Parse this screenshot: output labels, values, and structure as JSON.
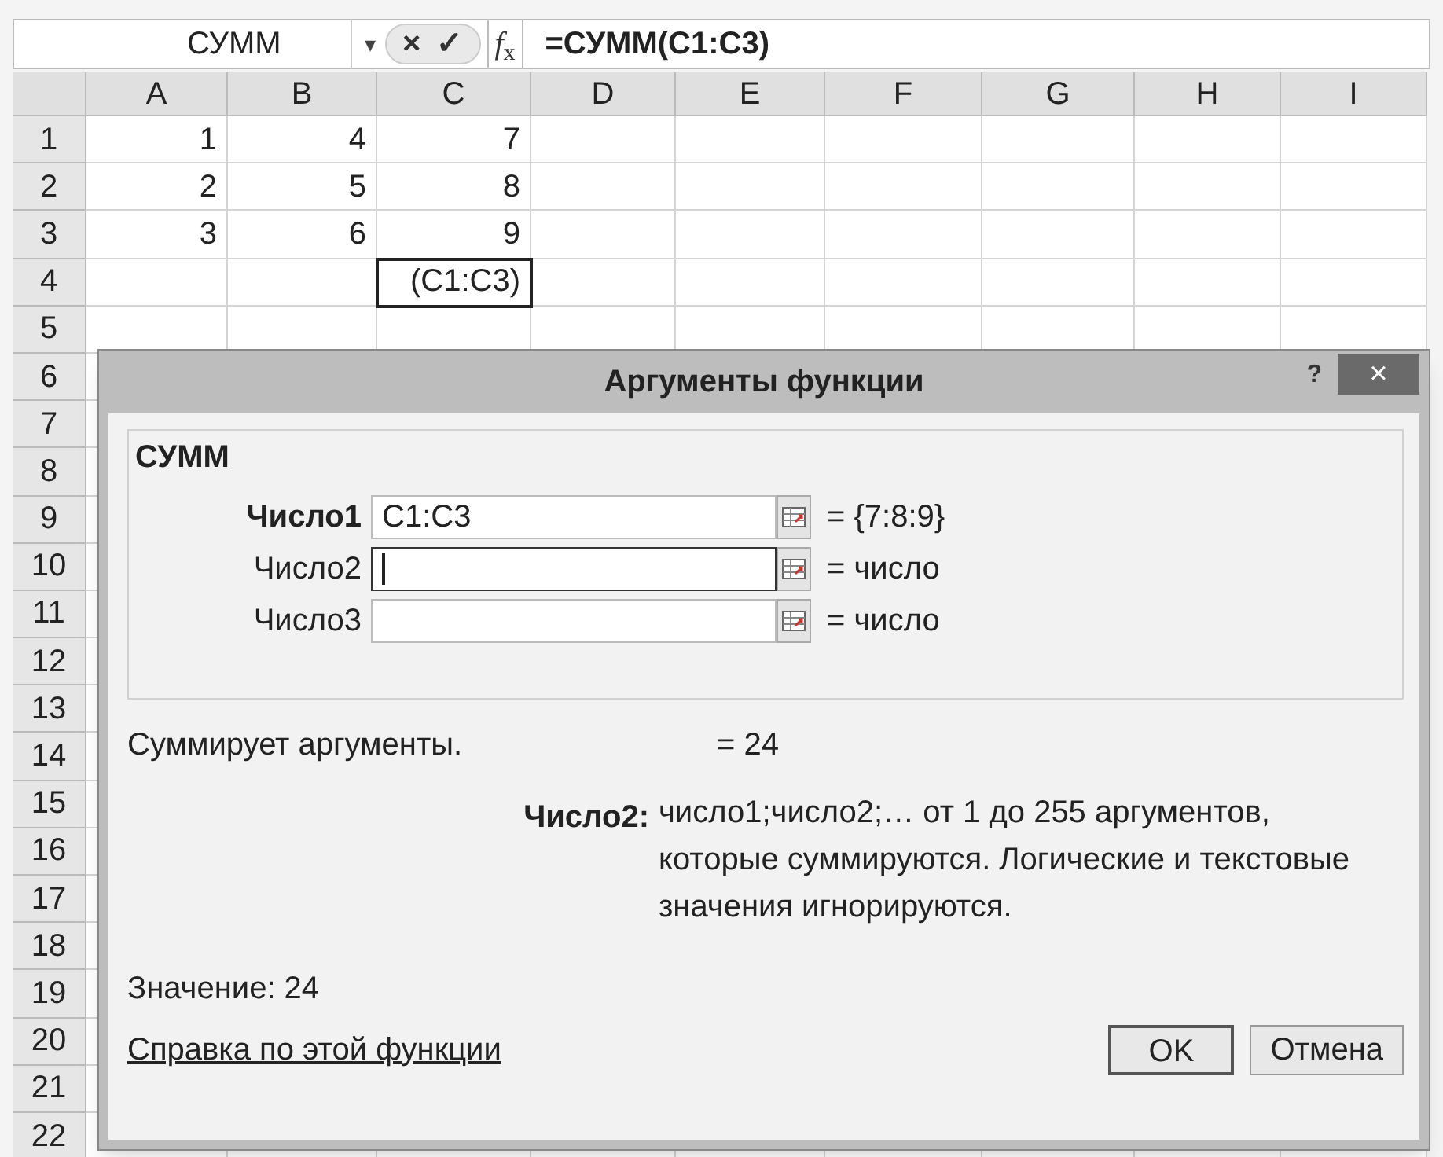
{
  "formula_bar": {
    "name_box": "СУММ",
    "dropdown": "▾",
    "cancel": "×",
    "enter": "✓",
    "fx": "*f*$_{x}$",
    "formula": "=СУММ(C1:C3)"
  },
  "columns": [
    "A",
    "B",
    "C",
    "D",
    "E",
    "F",
    "G",
    "H",
    "I"
  ],
  "rows": [
    {
      "label": "1",
      "cells": [
        {
          "text": "1",
          "selected": false
        },
        {
          "text": "4",
          "selected": false
        },
        {
          "text": "7",
          "selected": false
        }
      ]
    },
    {
      "label": "2",
      "cells": [
        {
          "text": "2",
          "selected": false
        },
        {
          "text": "5",
          "selected": false
        },
        {
          "text": "8",
          "selected": false
        }
      ]
    },
    {
      "label": "3",
      "cells": [
        {
          "text": "3",
          "selected": false
        },
        {
          "text": "6",
          "selected": false
        },
        {
          "text": "9",
          "selected": false
        }
      ]
    },
    {
      "label": "4",
      "cells": [
        null,
        null,
        {
          "text": "(C1:C3)",
          "selected": true
        }
      ]
    },
    {
      "label": "5"
    },
    {
      "label": "6"
    },
    {
      "label": "7"
    },
    {
      "label": "8"
    },
    {
      "label": "9"
    },
    {
      "label": "10"
    },
    {
      "label": "11"
    },
    {
      "label": "12"
    },
    {
      "label": "13"
    },
    {
      "label": "14"
    },
    {
      "label": "15"
    },
    {
      "label": "16"
    },
    {
      "label": "17"
    },
    {
      "label": "18"
    },
    {
      "label": "19"
    },
    {
      "label": "20"
    },
    {
      "label": "21"
    },
    {
      "label": "22"
    }
  ],
  "dialog": {
    "title": "Аргументы функции",
    "help": "?",
    "close": "×",
    "function_name": "СУММ",
    "arguments": [
      {
        "label": "Число1",
        "value": "C1:C3",
        "result": "= {7:8:9}",
        "required": true,
        "focused": false
      },
      {
        "label": "Число2",
        "result": "= число",
        "required": false,
        "focused": true
      },
      {
        "label": "Число3",
        "result": "= число",
        "required": false,
        "focused": false
      }
    ],
    "description": "Суммирует аргументы.",
    "result": "= 24",
    "argument_help": {
      "label": "Число2:",
      "text": "число1;число2;… от 1 до 255 аргументов, которые суммируются. Логические и текстовые значения игнорируются."
    },
    "value": "Значение: 24",
    "help_link": "Справка по этой функции",
    "buttons": [
      {
        "label": "OK",
        "default": true
      },
      {
        "label": "Отмена",
        "default": false
      }
    ]
  }
}
